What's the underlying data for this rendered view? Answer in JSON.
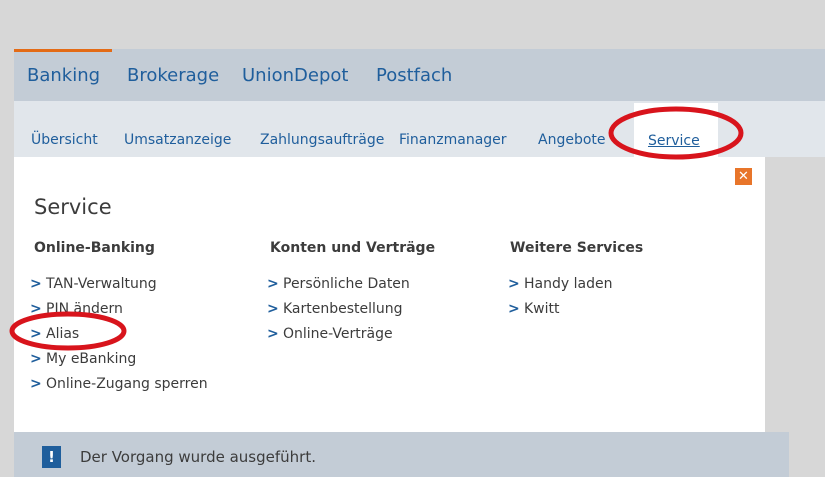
{
  "topnav": {
    "tabs": [
      {
        "label": "Banking"
      },
      {
        "label": "Brokerage"
      },
      {
        "label": "UnionDepot"
      },
      {
        "label": "Postfach"
      }
    ]
  },
  "subnav": {
    "items": [
      {
        "label": "Übersicht"
      },
      {
        "label": "Umsatzanzeige"
      },
      {
        "label": "Zahlungsaufträge"
      },
      {
        "label": "Finanzmanager"
      },
      {
        "label": "Angebote"
      },
      {
        "label": "Service"
      }
    ]
  },
  "panel": {
    "title": "Service",
    "close": "✕",
    "columns": [
      {
        "heading": "Online-Banking",
        "links": [
          "TAN-Verwaltung",
          "PIN ändern",
          "Alias",
          "My eBanking",
          "Online-Zugang sperren"
        ]
      },
      {
        "heading": "Konten und Verträge",
        "links": [
          "Persönliche Daten",
          "Kartenbestellung",
          "Online-Verträge"
        ]
      },
      {
        "heading": "Weitere Services",
        "links": [
          "Handy laden",
          "Kwitt"
        ]
      }
    ]
  },
  "message": {
    "icon": "!",
    "text": "Der Vorgang wurde ausgeführt."
  },
  "colors": {
    "accent": "#e36b16",
    "link": "#1f5e9c",
    "annotation": "#d8141c"
  }
}
